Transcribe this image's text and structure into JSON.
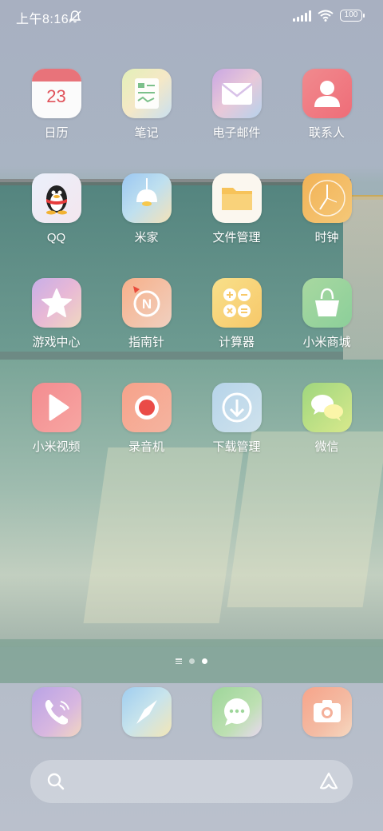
{
  "status_bar": {
    "time": "上午8:16",
    "battery": "100",
    "icons": [
      "do-not-disturb-icon",
      "signal-icon",
      "wifi-icon",
      "battery-icon"
    ]
  },
  "apps": [
    {
      "label": "日历",
      "icon": "calendar-icon",
      "badge_text": "23"
    },
    {
      "label": "笔记",
      "icon": "notes-icon"
    },
    {
      "label": "电子邮件",
      "icon": "email-icon"
    },
    {
      "label": "联系人",
      "icon": "contacts-icon"
    },
    {
      "label": "QQ",
      "icon": "qq-icon"
    },
    {
      "label": "米家",
      "icon": "mijia-icon"
    },
    {
      "label": "文件管理",
      "icon": "file-manager-icon"
    },
    {
      "label": "时钟",
      "icon": "clock-icon"
    },
    {
      "label": "游戏中心",
      "icon": "game-center-icon"
    },
    {
      "label": "指南针",
      "icon": "compass-icon"
    },
    {
      "label": "计算器",
      "icon": "calculator-icon"
    },
    {
      "label": "小米商城",
      "icon": "mi-store-icon"
    },
    {
      "label": "小米视频",
      "icon": "mi-video-icon"
    },
    {
      "label": "录音机",
      "icon": "recorder-icon"
    },
    {
      "label": "下载管理",
      "icon": "download-manager-icon"
    },
    {
      "label": "微信",
      "icon": "wechat-icon"
    }
  ],
  "page_indicator": {
    "pages": 2,
    "current": 2
  },
  "dock": [
    {
      "icon": "phone-icon"
    },
    {
      "icon": "browser-icon"
    },
    {
      "icon": "messages-icon"
    },
    {
      "icon": "camera-icon"
    }
  ],
  "search_bar": {
    "left_icon": "search-icon",
    "right_icon": "assistant-icon"
  },
  "colors": {
    "label": "#ffffff",
    "calendar_number": "#e0525a",
    "page_dot_active": "#ffffff"
  }
}
